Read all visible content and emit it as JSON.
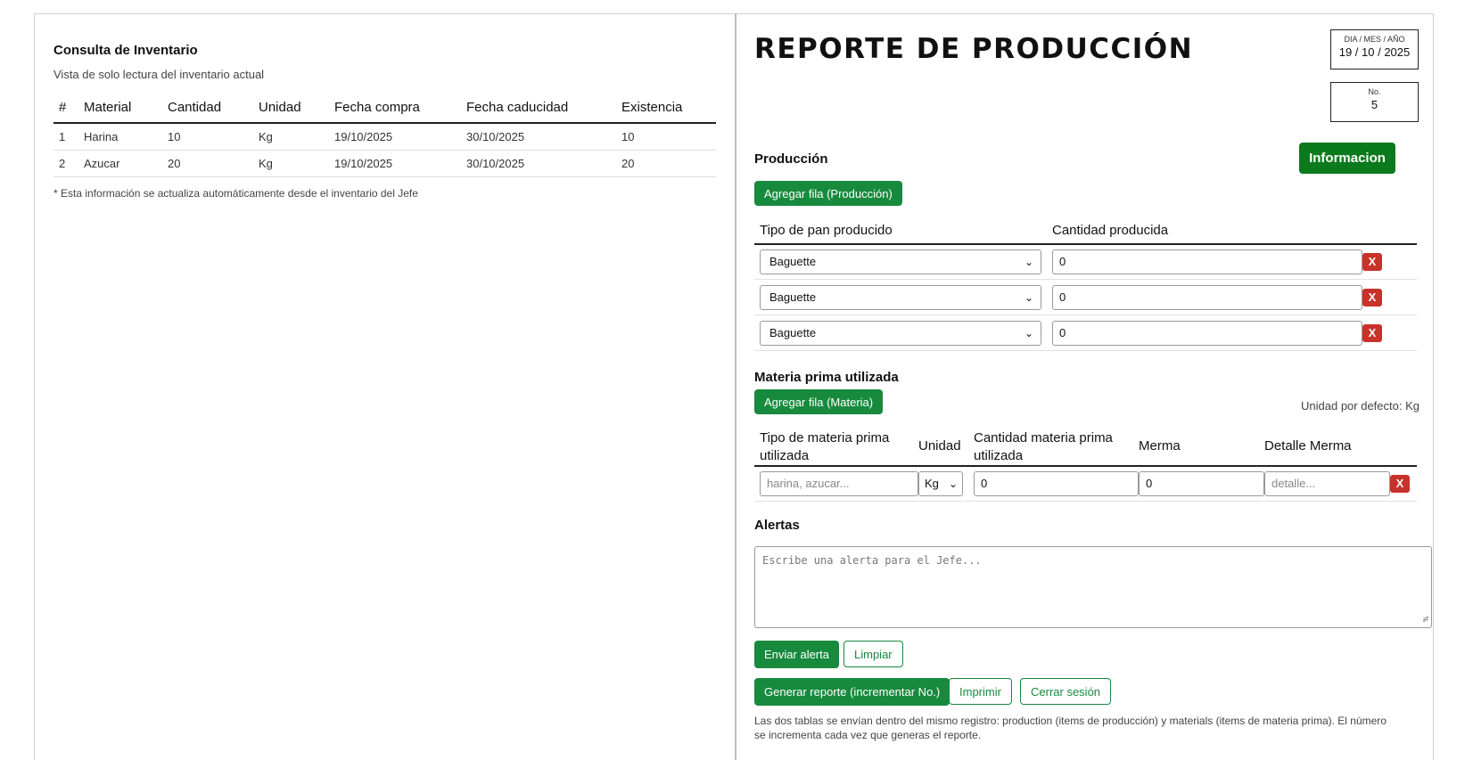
{
  "inventory": {
    "title": "Consulta de Inventario",
    "subtitle": "Vista de solo lectura del inventario actual",
    "columns": [
      "#",
      "Material",
      "Cantidad",
      "Unidad",
      "Fecha compra",
      "Fecha caducidad",
      "Existencia"
    ],
    "rows": [
      [
        "1",
        "Harina",
        "10",
        "Kg",
        "19/10/2025",
        "30/10/2025",
        "10"
      ],
      [
        "2",
        "Azucar",
        "20",
        "Kg",
        "19/10/2025",
        "30/10/2025",
        "20"
      ]
    ],
    "note": "* Esta información se actualiza automáticamente desde el inventario del Jefe"
  },
  "report": {
    "title": "REPORTE DE PRODUCCIÓN",
    "date_label": "DIA / MES / AÑO",
    "date_value": "19 / 10 / 2025",
    "no_label": "No.",
    "no_value": "5",
    "info_button": "Informacion",
    "production": {
      "title": "Producción",
      "add_button": "Agregar fila (Producción)",
      "col_type": "Tipo de pan producido",
      "col_qty": "Cantidad producida",
      "rows": [
        {
          "type": "Baguette",
          "qty": "0"
        },
        {
          "type": "Baguette",
          "qty": "0"
        },
        {
          "type": "Baguette",
          "qty": "0"
        }
      ],
      "remove_label": "X"
    },
    "materials": {
      "title": "Materia prima utilizada",
      "add_button": "Agregar fila (Materia)",
      "default_unit": "Unidad por defecto: Kg",
      "col_type_1": "Tipo de materia prima",
      "col_type_2": "utilizada",
      "col_unit": "Unidad",
      "col_qty_1": "Cantidad materia prima",
      "col_qty_2": "utilizada",
      "col_merma": "Merma",
      "col_detail": "Detalle Merma",
      "row": {
        "type_placeholder": "harina, azucar...",
        "unit": "Kg",
        "qty": "0",
        "merma": "0",
        "detail_placeholder": "detalle..."
      },
      "remove_label": "X"
    },
    "alerts": {
      "title": "Alertas",
      "placeholder": "Escribe una alerta para el Jefe...",
      "send_button": "Enviar alerta",
      "clear_button": "Limpiar"
    },
    "actions": {
      "generate": "Generar reporte (incrementar No.)",
      "print": "Imprimir",
      "logout": "Cerrar sesión"
    },
    "footer_note": "Las dos tablas se envían dentro del mismo registro: production (items de producción) y materials (items de materia prima). El número se incrementa cada vez que generas el reporte."
  },
  "colors": {
    "accent": "#178a3e",
    "info": "#0b7a1d",
    "danger": "#c8322a"
  }
}
